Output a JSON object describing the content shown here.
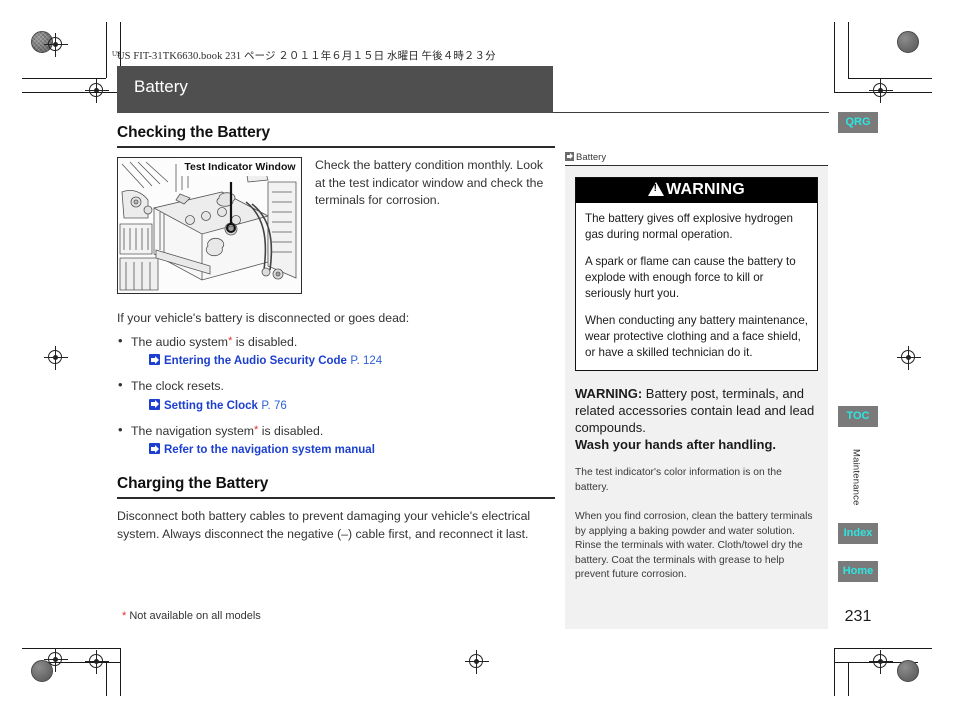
{
  "running_header": "US FIT-31TK6630.book   231 ページ   ２０１１年６月１５日   水曜日   午後４時２３分",
  "chapter_title": "Battery",
  "left": {
    "section1_heading": "Checking the Battery",
    "figure_caption": "Test Indicator Window",
    "figure_alt": "battery-engine-bay-illustration",
    "intro_text": "Check the battery condition monthly. Look at the test indicator window and check the terminals for corrosion.",
    "lead_in": "If your vehicle's battery is disconnected or goes dead:",
    "bullets": [
      {
        "text": "The audio system",
        "asterisk": "*",
        "text_after": " is disabled.",
        "xref_label": "Entering the Audio Security Code",
        "xref_page": "P. 124"
      },
      {
        "text": "The clock resets.",
        "asterisk": "",
        "text_after": "",
        "xref_label": "Setting the Clock",
        "xref_page": "P. 76"
      },
      {
        "text": "The navigation system",
        "asterisk": "*",
        "text_after": " is disabled.",
        "xref_label": "Refer to the navigation system manual",
        "xref_page": ""
      }
    ],
    "section2_heading": "Charging the Battery",
    "section2_text": "Disconnect both battery cables to prevent damaging your vehicle's electrical system. Always disconnect the negative (–) cable first, and reconnect it last."
  },
  "right": {
    "tab_label": "Battery",
    "warning_title": "WARNING",
    "warning_paragraphs": [
      "The battery gives off explosive hydrogen gas during normal operation.",
      "A spark or flame can cause the battery to explode with enough force to kill or seriously hurt you.",
      "When conducting any battery maintenance, wear protective clothing and a face shield, or have a skilled technician do it."
    ],
    "warning2_lead": "WARNING:",
    "warning2_text": " Battery post, terminals, and related accessories contain lead and lead compounds.",
    "warning2_strong": "Wash your hands after handling.",
    "note1": "The test indicator's color information is on the battery.",
    "note2": "When you find corrosion, clean the battery terminals by applying a baking powder and water solution. Rinse the terminals with water. Cloth/towel dry the battery. Coat the terminals with grease to help prevent future corrosion."
  },
  "tabs": {
    "qrg": "QRG",
    "toc": "TOC",
    "section": "Maintenance",
    "index": "Index",
    "home": "Home"
  },
  "footnote": {
    "star": "*",
    "text": " Not available on all models"
  },
  "page_number": "231",
  "colors": {
    "title_bar": "#4f4f4f",
    "link_blue": "#1c3fd0",
    "tab_text": "#2ee6e0",
    "tab_bg": "#7a7a7a",
    "asterisk_red": "#e03028",
    "panel_bg": "#f1f1f1"
  }
}
